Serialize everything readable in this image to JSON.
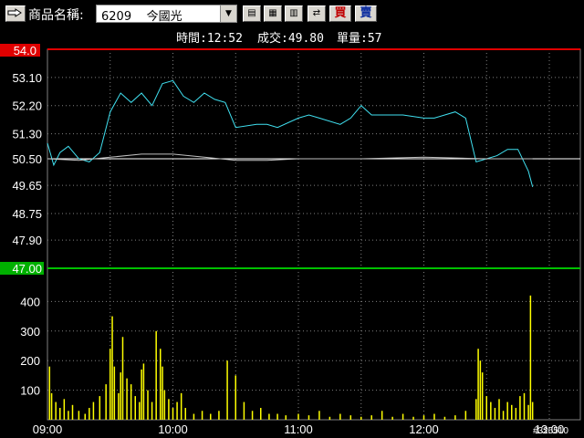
{
  "toolbar": {
    "stock_label": "商品名稱:",
    "stock_code": "6209",
    "stock_name": "今國光",
    "buy_label": "買",
    "sell_label": "賣",
    "icons": [
      "hand-pointer-icon",
      "chart-view-icon",
      "calendar-icon",
      "calculator-icon",
      "transfer-icon"
    ]
  },
  "info_bar": {
    "time": "時間:12:52",
    "price": "成交:49.80",
    "volume": "單量:57"
  },
  "chart_data": [
    {
      "type": "line",
      "y_ticks": [
        "53.10",
        "52.20",
        "51.30",
        "50.50",
        "49.65",
        "48.75",
        "47.90"
      ],
      "top_label": "54.0",
      "bottom_label": "47.00",
      "ylim": [
        47.0,
        54.0
      ],
      "reference_price": 50.5,
      "x_ticks": [
        "09:00",
        "10:00",
        "11:00",
        "12:00",
        "13:00"
      ],
      "series": [
        {
          "color": "#40e0f0",
          "x": [
            "09:00",
            "09:03",
            "09:06",
            "09:10",
            "09:15",
            "09:20",
            "09:25",
            "09:30",
            "09:35",
            "09:40",
            "09:45",
            "09:50",
            "09:55",
            "10:00",
            "10:05",
            "10:10",
            "10:15",
            "10:20",
            "10:25",
            "10:30",
            "10:40",
            "10:45",
            "10:50",
            "11:00",
            "11:05",
            "11:10",
            "11:20",
            "11:25",
            "11:30",
            "11:35",
            "11:40",
            "11:50",
            "12:00",
            "12:05",
            "12:10",
            "12:15",
            "12:20",
            "12:25",
            "12:30",
            "12:35",
            "12:40",
            "12:45",
            "12:50",
            "12:52"
          ],
          "values": [
            51.0,
            50.3,
            50.7,
            50.9,
            50.5,
            50.4,
            50.7,
            52.0,
            52.6,
            52.3,
            52.6,
            52.2,
            52.9,
            53.0,
            52.5,
            52.3,
            52.6,
            52.4,
            52.3,
            51.5,
            51.6,
            51.6,
            51.5,
            51.8,
            51.9,
            51.8,
            51.6,
            51.8,
            52.2,
            51.9,
            51.9,
            51.9,
            51.8,
            51.8,
            51.9,
            52.0,
            51.8,
            50.4,
            50.5,
            50.6,
            50.8,
            50.8,
            50.1,
            49.6
          ]
        },
        {
          "color": "#c0c0c0",
          "x": [
            "09:00",
            "09:15",
            "09:30",
            "09:45",
            "10:00",
            "10:15",
            "10:30",
            "10:45",
            "11:00",
            "11:30",
            "12:00",
            "12:30",
            "12:52"
          ],
          "values": [
            50.5,
            50.45,
            50.55,
            50.65,
            50.65,
            50.55,
            50.45,
            50.45,
            50.5,
            50.5,
            50.55,
            50.5,
            50.5
          ]
        }
      ]
    },
    {
      "type": "bar",
      "y_ticks": [
        "400",
        "300",
        "200",
        "100"
      ],
      "ylim": [
        0,
        500
      ],
      "x_ticks": [
        "09:00",
        "10:00",
        "11:00",
        "12:00",
        "13:00"
      ],
      "color": "#ffff00",
      "x": [
        "09:01",
        "09:02",
        "09:04",
        "09:06",
        "09:08",
        "09:10",
        "09:12",
        "09:15",
        "09:18",
        "09:20",
        "09:22",
        "09:25",
        "09:28",
        "09:30",
        "09:31",
        "09:32",
        "09:34",
        "09:35",
        "09:36",
        "09:38",
        "09:40",
        "09:42",
        "09:44",
        "09:45",
        "09:46",
        "09:48",
        "09:50",
        "09:52",
        "09:54",
        "09:55",
        "09:56",
        "09:58",
        "10:00",
        "10:02",
        "10:04",
        "10:06",
        "10:10",
        "10:14",
        "10:18",
        "10:22",
        "10:26",
        "10:30",
        "10:34",
        "10:38",
        "10:42",
        "10:46",
        "10:50",
        "10:54",
        "11:00",
        "11:05",
        "11:10",
        "11:15",
        "11:20",
        "11:25",
        "11:30",
        "11:35",
        "11:40",
        "11:45",
        "11:50",
        "11:55",
        "12:00",
        "12:05",
        "12:10",
        "12:15",
        "12:20",
        "12:25",
        "12:26",
        "12:27",
        "12:28",
        "12:30",
        "12:32",
        "12:34",
        "12:36",
        "12:38",
        "12:40",
        "12:42",
        "12:44",
        "12:46",
        "12:48",
        "12:50",
        "12:51",
        "12:52"
      ],
      "values": [
        180,
        90,
        60,
        40,
        70,
        30,
        50,
        30,
        20,
        40,
        60,
        80,
        120,
        240,
        350,
        180,
        90,
        160,
        280,
        140,
        120,
        80,
        60,
        170,
        190,
        100,
        60,
        300,
        240,
        180,
        100,
        70,
        40,
        60,
        90,
        40,
        20,
        30,
        20,
        30,
        200,
        150,
        60,
        30,
        40,
        20,
        20,
        15,
        20,
        15,
        30,
        10,
        20,
        15,
        10,
        15,
        30,
        10,
        20,
        10,
        15,
        20,
        10,
        15,
        30,
        70,
        240,
        200,
        160,
        80,
        60,
        40,
        70,
        30,
        60,
        50,
        40,
        80,
        90,
        50,
        420,
        60
      ]
    }
  ]
}
